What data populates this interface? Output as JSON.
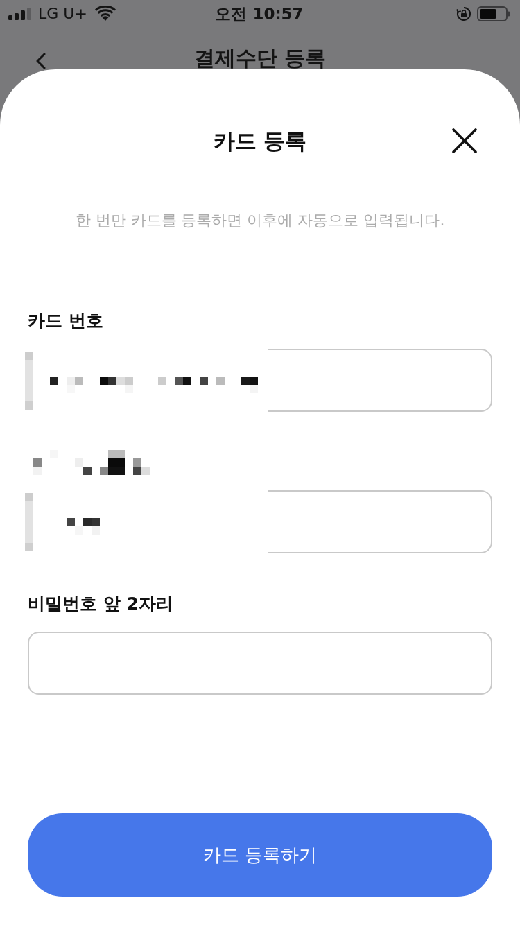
{
  "status_bar": {
    "carrier": "LG U+",
    "time": "오전 10:57"
  },
  "background_screen": {
    "title": "결제수단 등록"
  },
  "sheet": {
    "title": "카드 등록",
    "description": "한 번만 카드를 등록하면 이후에 자동으로 입력됩니다.",
    "fields": [
      {
        "label": "카드 번호",
        "label_redacted": false,
        "value_redacted": true
      },
      {
        "label_redacted": true,
        "value_redacted": true
      },
      {
        "label": "비밀번호 앞 2자리",
        "label_redacted": false,
        "value_redacted": false
      }
    ],
    "submit_button": "카드 등록하기"
  }
}
